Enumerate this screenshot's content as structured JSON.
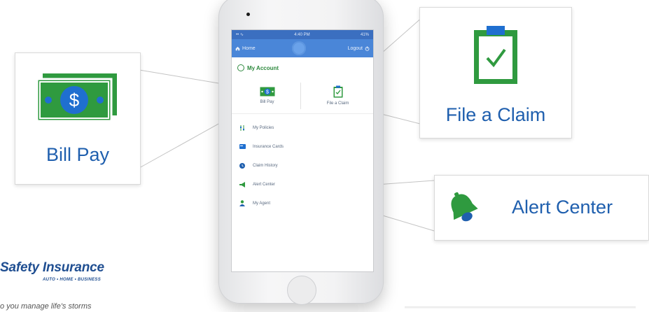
{
  "phone": {
    "status_bar": {
      "carrier": "•• ∿",
      "time": "4:40 PM",
      "battery": "41%"
    },
    "nav": {
      "home_label": "Home",
      "logout_label": "Logout"
    },
    "account": {
      "label": "My Account"
    },
    "tiles": [
      {
        "label": "Bill Pay",
        "icon": "cash-icon"
      },
      {
        "label": "File a Claim",
        "icon": "clipboard-check-icon"
      }
    ],
    "menu": [
      {
        "label": "My Policies",
        "icon": "sliders-icon"
      },
      {
        "label": "Insurance Cards",
        "icon": "card-icon"
      },
      {
        "label": "Claim History",
        "icon": "history-icon"
      },
      {
        "label": "Alert Center",
        "icon": "megaphone-icon"
      },
      {
        "label": "My Agent",
        "icon": "person-icon"
      }
    ]
  },
  "callouts": {
    "bill_pay": {
      "label": "Bill Pay",
      "icon": "cash-icon"
    },
    "file_claim": {
      "label": "File a Claim",
      "icon": "clipboard-check-icon"
    },
    "alert_center": {
      "label": "Alert Center",
      "icon": "bell-icon"
    }
  },
  "brand": {
    "name": "Safety Insurance",
    "subtitle": "AUTO • HOME • BUSINESS",
    "tagline": "o you manage life's storms"
  },
  "colors": {
    "brand_blue": "#1f5fae",
    "nav_blue": "#4a86d8",
    "icon_green": "#2f9a3f"
  }
}
